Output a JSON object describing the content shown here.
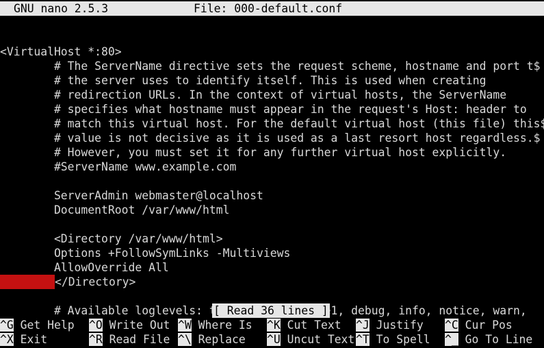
{
  "title": {
    "app_version": "GNU nano 2.5.3",
    "file_label": "File: 000-default.conf"
  },
  "file_lines": [
    "",
    "<VirtualHost *:80>",
    "        # The ServerName directive sets the request scheme, hostname and port t$",
    "        # the server uses to identify itself. This is used when creating",
    "        # redirection URLs. In the context of virtual hosts, the ServerName",
    "        # specifies what hostname must appear in the request's Host: header to",
    "        # match this virtual host. For the default virtual host (this file) this$",
    "        # value is not decisive as it is used as a last resort host regardless.$",
    "        # However, you must set it for any further virtual host explicitly.",
    "        #ServerName www.example.com",
    "",
    "        ServerAdmin webmaster@localhost",
    "        DocumentRoot /var/www/html",
    "",
    "        <Directory /var/www/html>",
    "        Options +FollowSymLinks -Multiviews",
    "        AllowOverride All",
    "        </Directory>",
    "",
    "        # Available loglevels: trace8, ..., trace1, debug, info, notice, warn,"
  ],
  "highlight": {
    "trailing_whitespace_line": 17,
    "color": "#c41111"
  },
  "status": "[ Read 36 lines ]",
  "shortcuts_row1": [
    {
      "key": "^G",
      "label": "Get Help"
    },
    {
      "key": "^O",
      "label": "Write Out"
    },
    {
      "key": "^W",
      "label": "Where Is"
    },
    {
      "key": "^K",
      "label": "Cut Text"
    },
    {
      "key": "^J",
      "label": "Justify"
    },
    {
      "key": "^C",
      "label": "Cur Pos"
    }
  ],
  "shortcuts_row2": [
    {
      "key": "^X",
      "label": "Exit"
    },
    {
      "key": "^R",
      "label": "Read File"
    },
    {
      "key": "^\\",
      "label": "Replace"
    },
    {
      "key": "^U",
      "label": "Uncut Text"
    },
    {
      "key": "^T",
      "label": "To Spell"
    },
    {
      "key": "^_",
      "label": "Go To Line"
    }
  ],
  "colors": {
    "background": "#000000",
    "foreground": "#d9d9d9",
    "inverse_bg": "#e6e6e6",
    "inverse_fg": "#000000"
  }
}
